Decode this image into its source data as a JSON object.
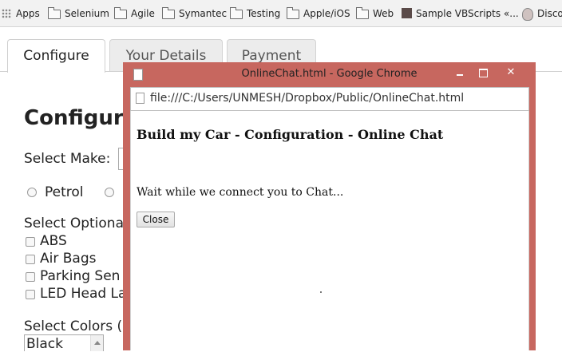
{
  "bookmarks": [
    {
      "label": "Apps",
      "icon": "apps-grid-icon"
    },
    {
      "label": "Selenium",
      "icon": "folder-icon"
    },
    {
      "label": "Agile",
      "icon": "folder-icon"
    },
    {
      "label": "Symantec",
      "icon": "folder-icon"
    },
    {
      "label": "Testing",
      "icon": "folder-icon"
    },
    {
      "label": "Apple/iOS",
      "icon": "folder-icon"
    },
    {
      "label": "Web",
      "icon": "folder-icon"
    },
    {
      "label": "Sample VBScripts «...",
      "icon": "site-icon"
    },
    {
      "label": "Disco",
      "icon": "site-icon"
    }
  ],
  "page": {
    "tabs": [
      "Configure",
      "Your Details",
      "Payment"
    ],
    "heading": "Configur",
    "select_make": "Select Make:",
    "fuel": [
      "Petrol"
    ],
    "optional_label": "Select Optiona",
    "options": [
      "ABS",
      "Air Bags",
      "Parking Sen",
      "LED Head La"
    ],
    "colors_label": "Select Colors (",
    "color_value": "Black"
  },
  "popup": {
    "title": "OnlineChat.html - Google Chrome",
    "url": "file:///C:/Users/UNMESH/Dropbox/Public/OnlineChat.html",
    "heading": "Build my Car - Configuration - Online Chat",
    "message": "Wait while we connect you to Chat...",
    "close_button": "Close",
    "title_color": "#c7675f"
  }
}
